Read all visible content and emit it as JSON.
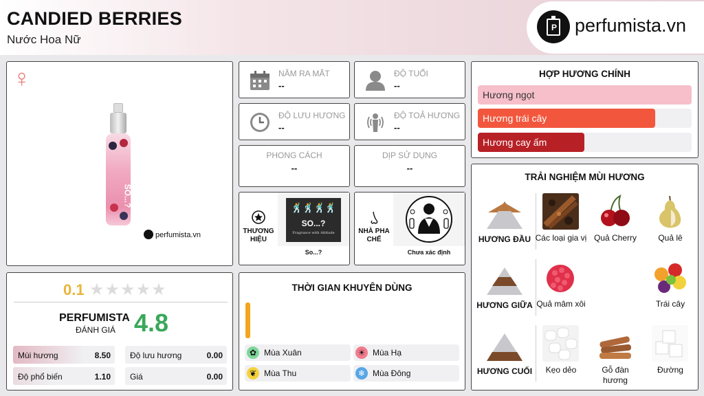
{
  "header": {
    "title": "CANDIED BERRIES",
    "subtitle": "Nước Hoa Nữ",
    "logo_text": "perfumista.vn"
  },
  "product": {
    "gender_icon": "female-symbol-icon",
    "bottle_brand": "SO...?",
    "watermark": "perfumista.vn"
  },
  "info": {
    "release_year": {
      "label": "NĂM RA MẮT",
      "value": "--",
      "icon": "calendar-icon"
    },
    "age": {
      "label": "ĐỘ TUỔI",
      "value": "--",
      "icon": "user-icon"
    },
    "longevity": {
      "label": "ĐỘ LƯU HƯƠNG",
      "value": "--",
      "icon": "clock-icon"
    },
    "sillage": {
      "label": "ĐỘ TOẢ HƯƠNG",
      "value": "--",
      "icon": "aura-icon"
    },
    "style": {
      "label": "PHONG CÁCH",
      "value": "--"
    },
    "occasion": {
      "label": "DỊP SỬ DỤNG",
      "value": "--"
    }
  },
  "brand": {
    "label": "THƯƠNG HIỆU",
    "logo_text": "SO...?",
    "tagline": "Fragrance with Attitude",
    "name": "So...?",
    "icon": "star-badge-icon"
  },
  "perfumer": {
    "label": "NHÀ PHA CHẾ",
    "name": "Chưa xác định",
    "icon": "nose-icon"
  },
  "accords": {
    "title": "HỢP HƯƠNG CHÍNH",
    "items": [
      {
        "label": "Hương ngọt",
        "percent": 100,
        "color": "#f6bfca",
        "text_color": "#333333"
      },
      {
        "label": "Hương trái cây",
        "percent": 83,
        "color": "#f2573d",
        "text_color": "#ffffff"
      },
      {
        "label": "Hương cay ấm",
        "percent": 50,
        "color": "#b72126",
        "text_color": "#ffffff"
      }
    ]
  },
  "notes": {
    "title": "TRẢI NGHIỆM MÙI HƯƠNG",
    "tiers": [
      {
        "label": "HƯƠNG ĐẦU",
        "items": [
          {
            "name": "Các loại gia vị",
            "icon": "spices-icon"
          },
          {
            "name": "Quả Cherry",
            "icon": "cherry-icon"
          },
          {
            "name": "Quả lê",
            "icon": "pear-icon"
          }
        ]
      },
      {
        "label": "HƯƠNG GIỮA",
        "items": [
          {
            "name": "Quả mâm xôi",
            "icon": "raspberry-icon"
          },
          {
            "name": "Trái cây",
            "icon": "fruits-icon"
          }
        ]
      },
      {
        "label": "HƯƠNG CUỐI",
        "items": [
          {
            "name": "Kẹo dẻo",
            "icon": "marshmallow-icon"
          },
          {
            "name": "Gỗ đàn hương",
            "icon": "sandalwood-icon"
          },
          {
            "name": "Đường",
            "icon": "sugar-icon"
          }
        ]
      }
    ]
  },
  "rating": {
    "user_score": "0.1",
    "user_stars": 0.1,
    "max_stars": 5,
    "brand_label": "PERFUMISTA",
    "brand_sub": "ĐÁNH GIÁ",
    "brand_score": "4.8",
    "metrics": [
      {
        "label": "Mùi hương",
        "value": "8.50"
      },
      {
        "label": "Độ lưu hương",
        "value": "0.00"
      },
      {
        "label": "Độ phổ biến",
        "value": "1.10"
      },
      {
        "label": "Giá",
        "value": "0.00"
      }
    ]
  },
  "seasons": {
    "title": "THỜI GIAN KHUYÊN DÙNG",
    "items": [
      {
        "label": "Mùa Xuân",
        "icon": "flower-icon",
        "color": "#7dd69a"
      },
      {
        "label": "Mùa Hạ",
        "icon": "sun-icon",
        "color": "#f07b8c"
      },
      {
        "label": "Mùa Thu",
        "icon": "leaf-icon",
        "color": "#f3d23b"
      },
      {
        "label": "Mùa Đông",
        "icon": "snowflake-icon",
        "color": "#58a6e6"
      }
    ]
  }
}
